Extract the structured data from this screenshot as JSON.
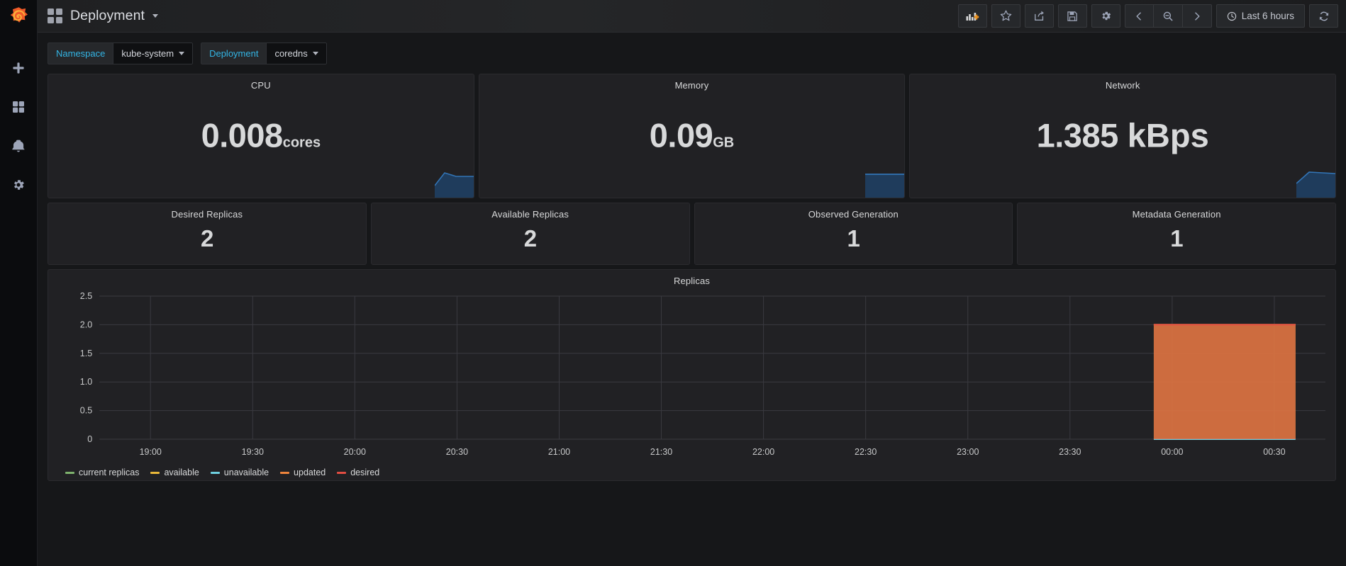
{
  "sidebar": {
    "brand_icon": "grafana-logo",
    "items": [
      {
        "icon": "plus-icon",
        "name": "create"
      },
      {
        "icon": "dashboards-icon",
        "name": "dashboards"
      },
      {
        "icon": "bell-icon",
        "name": "alerting"
      },
      {
        "icon": "gear-icon",
        "name": "configuration"
      }
    ]
  },
  "navbar": {
    "dashboard_icon": "dashboard-grid-icon",
    "title": "Deployment",
    "caret_icon": "chevron-down-icon",
    "actions": [
      {
        "icon": "add-panel-icon",
        "name": "add-panel"
      },
      {
        "icon": "star-icon",
        "name": "mark-favorite"
      },
      {
        "icon": "share-icon",
        "name": "share-dashboard"
      },
      {
        "icon": "save-icon",
        "name": "save-dashboard"
      },
      {
        "icon": "gear-icon",
        "name": "dashboard-settings"
      },
      {
        "icon": "chevron-left-icon",
        "name": "time-shift-back"
      },
      {
        "icon": "zoom-out-icon",
        "name": "zoom-out-time-range"
      },
      {
        "icon": "chevron-right-icon",
        "name": "time-shift-forward"
      }
    ],
    "time_picker": {
      "icon": "clock-icon",
      "label": "Last 6 hours"
    },
    "refresh": {
      "icon": "refresh-icon",
      "name": "refresh-dashboard"
    }
  },
  "submenu": {
    "variables": [
      {
        "label": "Namespace",
        "value": "kube-system",
        "caret": "chevron-down-icon"
      },
      {
        "label": "Deployment",
        "value": "coredns",
        "caret": "chevron-down-icon"
      }
    ]
  },
  "panels": {
    "top_stats": [
      {
        "title": "CPU",
        "value": "0.008",
        "unit": "cores",
        "unit_same_size": false,
        "sparkline": "ramp"
      },
      {
        "title": "Memory",
        "value": "0.09",
        "unit": "GB",
        "unit_same_size": false,
        "sparkline": "flat"
      },
      {
        "title": "Network",
        "value": "1.385",
        "unit": " kBps",
        "unit_same_size": true,
        "sparkline": "ramp"
      }
    ],
    "replica_stats": [
      {
        "title": "Desired Replicas",
        "value": "2"
      },
      {
        "title": "Available Replicas",
        "value": "2"
      },
      {
        "title": "Observed Generation",
        "value": "1"
      },
      {
        "title": "Metadata Generation",
        "value": "1"
      }
    ],
    "graph": {
      "title": "Replicas"
    }
  },
  "colors": {
    "accent_blue": "#33b5e5",
    "sparkline_line": "#3274b5",
    "sparkline_fill": "#1f3c5c",
    "green": "#7eb26d",
    "yellow": "#eab839",
    "cyan": "#6ed0e0",
    "orange": "#ef843c",
    "red": "#e24d42",
    "panel_bg": "#212124",
    "page_bg": "#161719"
  },
  "chart_data": {
    "type": "line",
    "title": "Replicas",
    "xlabel": "",
    "ylabel": "",
    "ylim": [
      0,
      2.5
    ],
    "yticks": [
      "0",
      "0.5",
      "1.0",
      "1.5",
      "2.0",
      "2.5"
    ],
    "ytick_values": [
      0,
      0.5,
      1.0,
      1.5,
      2.0,
      2.5
    ],
    "xticks": [
      "19:00",
      "19:30",
      "20:00",
      "20:30",
      "21:00",
      "21:30",
      "22:00",
      "22:30",
      "23:00",
      "23:30",
      "00:00",
      "00:30"
    ],
    "grid": true,
    "legend_position": "bottom-left",
    "fill_opacity": 0.45,
    "data_start_x_fraction": 0.86,
    "series": [
      {
        "name": "current replicas",
        "color": "#7eb26d",
        "value_in_window": 2,
        "x": [
          "19:00",
          "23:57",
          "00:00",
          "00:30",
          "00:45"
        ],
        "y": [
          null,
          null,
          2,
          2,
          2
        ]
      },
      {
        "name": "available",
        "color": "#eab839",
        "value_in_window": 2,
        "x": [
          "19:00",
          "23:57",
          "00:00",
          "00:30",
          "00:45"
        ],
        "y": [
          null,
          null,
          2,
          2,
          2
        ]
      },
      {
        "name": "unavailable",
        "color": "#6ed0e0",
        "value_in_window": 0,
        "x": [
          "19:00",
          "23:57",
          "00:00",
          "00:30",
          "00:45"
        ],
        "y": [
          null,
          null,
          0,
          0,
          0
        ]
      },
      {
        "name": "updated",
        "color": "#ef843c",
        "value_in_window": 2,
        "x": [
          "19:00",
          "23:57",
          "00:00",
          "00:30",
          "00:45"
        ],
        "y": [
          null,
          null,
          2,
          2,
          2
        ]
      },
      {
        "name": "desired",
        "color": "#e24d42",
        "value_in_window": 2,
        "x": [
          "19:00",
          "23:57",
          "00:00",
          "00:30",
          "00:45"
        ],
        "y": [
          null,
          null,
          2,
          2,
          2
        ]
      }
    ]
  }
}
